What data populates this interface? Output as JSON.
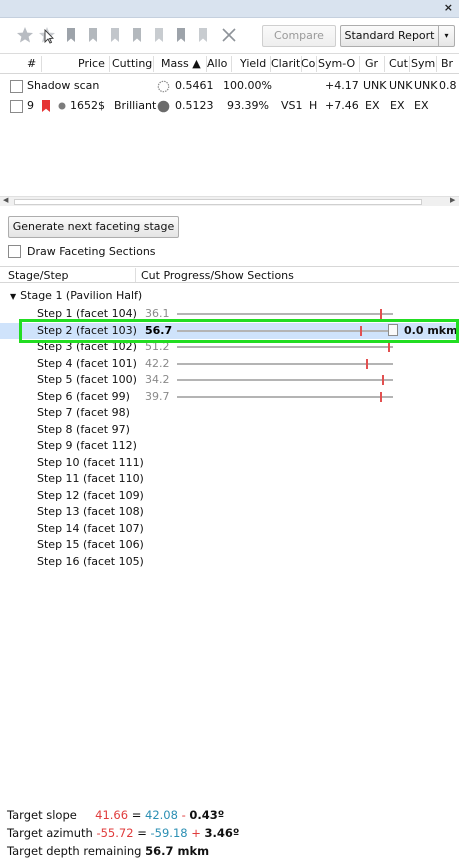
{
  "window": {
    "close_glyph": "×"
  },
  "toolbar": {
    "icons": [
      "star-icon",
      "star-icon",
      "bookmark-icon",
      "bookmark-icon",
      "bookmark-icon",
      "bookmark-icon",
      "bookmark-icon",
      "bookmark-icon",
      "bookmark-icon",
      "close-icon"
    ],
    "compare_label": "Compare",
    "report_label": "Standard Report",
    "report_arrow": "▾"
  },
  "grid": {
    "columns": [
      "#",
      "Price",
      "Cutting",
      "Mass ▲",
      "Allo",
      "Yield",
      "Clarity",
      "Co",
      "Sym-O",
      "Gr",
      "Cut",
      "Sym",
      "Br"
    ],
    "rows": [
      {
        "name": "Shadow scan",
        "mass": "0.5461",
        "yield": "100.00%",
        "sym_o": "+4.17",
        "gr": "UNK",
        "cut": "UNK",
        "sym": "UNK",
        "br": "0.8"
      },
      {
        "num": "9",
        "price": "1652$",
        "cutting": "Brilliant",
        "mass": "0.5123",
        "yield": "93.39%",
        "clarity": "VS1",
        "color": "H",
        "sym_o": "+7.46",
        "gr": "EX",
        "cut": "EX",
        "sym": "EX"
      }
    ]
  },
  "actions": {
    "generate_label": "Generate next faceting stage",
    "draw_sections_label": "Draw Faceting Sections"
  },
  "tree": {
    "col_stage": "Stage/Step",
    "col_progress": "Cut Progress/Show Sections",
    "stage_label": "Stage 1 (Pavilion Half)",
    "steps": [
      {
        "label": "Step 1 (facet 104)",
        "value": "36.1"
      },
      {
        "label": "Step 2 (facet 103)",
        "value": "56.7",
        "depth": "0.0 mkm",
        "selected": true
      },
      {
        "label": "Step 3 (facet 102)",
        "value": "51.2"
      },
      {
        "label": "Step 4 (facet 101)",
        "value": "42.2"
      },
      {
        "label": "Step 5 (facet 100)",
        "value": "34.2"
      },
      {
        "label": "Step 6 (facet 99)",
        "value": "39.7"
      },
      {
        "label": "Step 7 (facet 98)"
      },
      {
        "label": "Step 8 (facet 97)"
      },
      {
        "label": "Step 9 (facet 112)"
      },
      {
        "label": "Step 10 (facet 111)"
      },
      {
        "label": "Step 11 (facet 110)"
      },
      {
        "label": "Step 12 (facet 109)"
      },
      {
        "label": "Step 13 (facet 108)"
      },
      {
        "label": "Step 14 (facet 107)"
      },
      {
        "label": "Step 15 (facet 106)"
      },
      {
        "label": "Step 16 (facet 105)"
      }
    ]
  },
  "targets": {
    "slope_label": "Target slope",
    "slope_target": "41.66",
    "slope_eq": "=",
    "slope_current": "42.08",
    "slope_op": "-",
    "slope_diff": "0.43º",
    "azimuth_label": "Target azimuth",
    "azimuth_target": "-55.72",
    "azimuth_eq": "=",
    "azimuth_current": "-59.18",
    "azimuth_op": "+",
    "azimuth_diff": "3.46º",
    "depth_label": "Target depth remaining",
    "depth_value": "56.7 mkm"
  },
  "colors": {
    "selection": "#cfe3fb",
    "highlight": "#22dd22",
    "marker": "#e25050",
    "red": "#e03c3c",
    "teal": "#2b8fb3"
  }
}
